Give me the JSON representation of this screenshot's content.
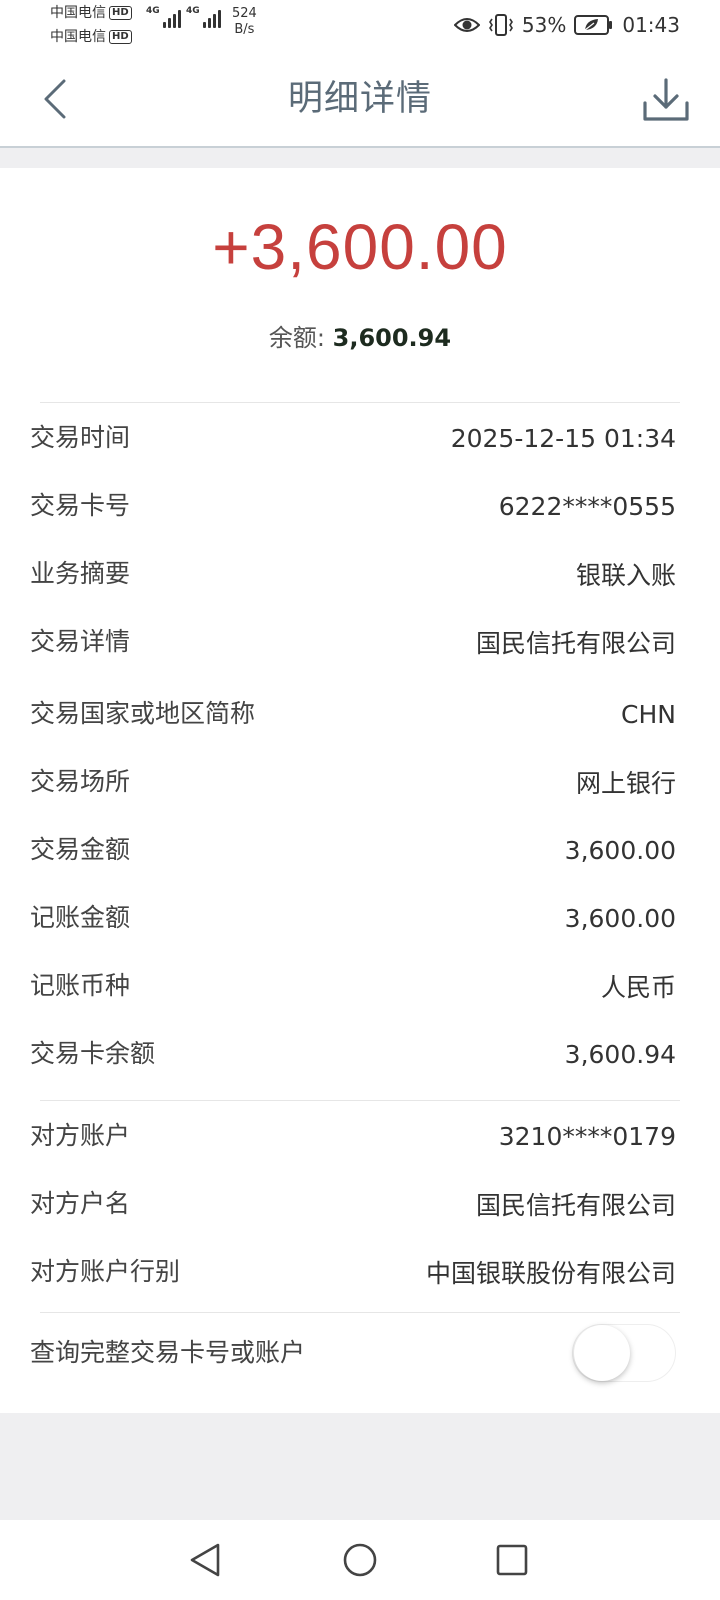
{
  "status_bar": {
    "carrier_1": "中国电信",
    "carrier_2": "中国电信",
    "hd_badge": "HD",
    "network_type": "4G",
    "speed_value": "524",
    "speed_unit": "B/s",
    "battery": "53%",
    "time": "01:43",
    "icons": [
      "eye-icon",
      "vibrate-icon",
      "battery-saver-icon"
    ]
  },
  "header": {
    "title": "明细详情",
    "back_icon": "chevron-left-icon",
    "download_icon": "download-icon"
  },
  "summary": {
    "amount": "+3,600.00",
    "balance_label": "余额:",
    "balance_value": "3,600.94",
    "amount_color": "#c6403d"
  },
  "details": [
    {
      "label": "交易时间",
      "value": "2025-12-15 01:34"
    },
    {
      "label": "交易卡号",
      "value": "6222****0555"
    },
    {
      "label": "业务摘要",
      "value": "银联入账"
    },
    {
      "label": "交易详情",
      "value": "国民信托有限公司"
    },
    {
      "label": "交易国家或地区简称",
      "value": "CHN"
    },
    {
      "label": "交易场所",
      "value": "网上银行"
    },
    {
      "label": "交易金额",
      "value": "3,600.00"
    },
    {
      "label": "记账金额",
      "value": "3,600.00"
    },
    {
      "label": "记账币种",
      "value": "人民币"
    },
    {
      "label": "交易卡余额",
      "value": "3,600.94"
    }
  ],
  "counterparty": [
    {
      "label": "对方账户",
      "value": "3210****0179"
    },
    {
      "label": "对方户名",
      "value": "国民信托有限公司"
    },
    {
      "label": "对方账户行别",
      "value": "中国银联股份有限公司"
    }
  ],
  "full_number_toggle": {
    "label": "查询完整交易卡号或账户",
    "enabled": false
  },
  "system_nav": [
    "back-triangle-icon",
    "home-circle-icon",
    "recents-square-icon"
  ]
}
